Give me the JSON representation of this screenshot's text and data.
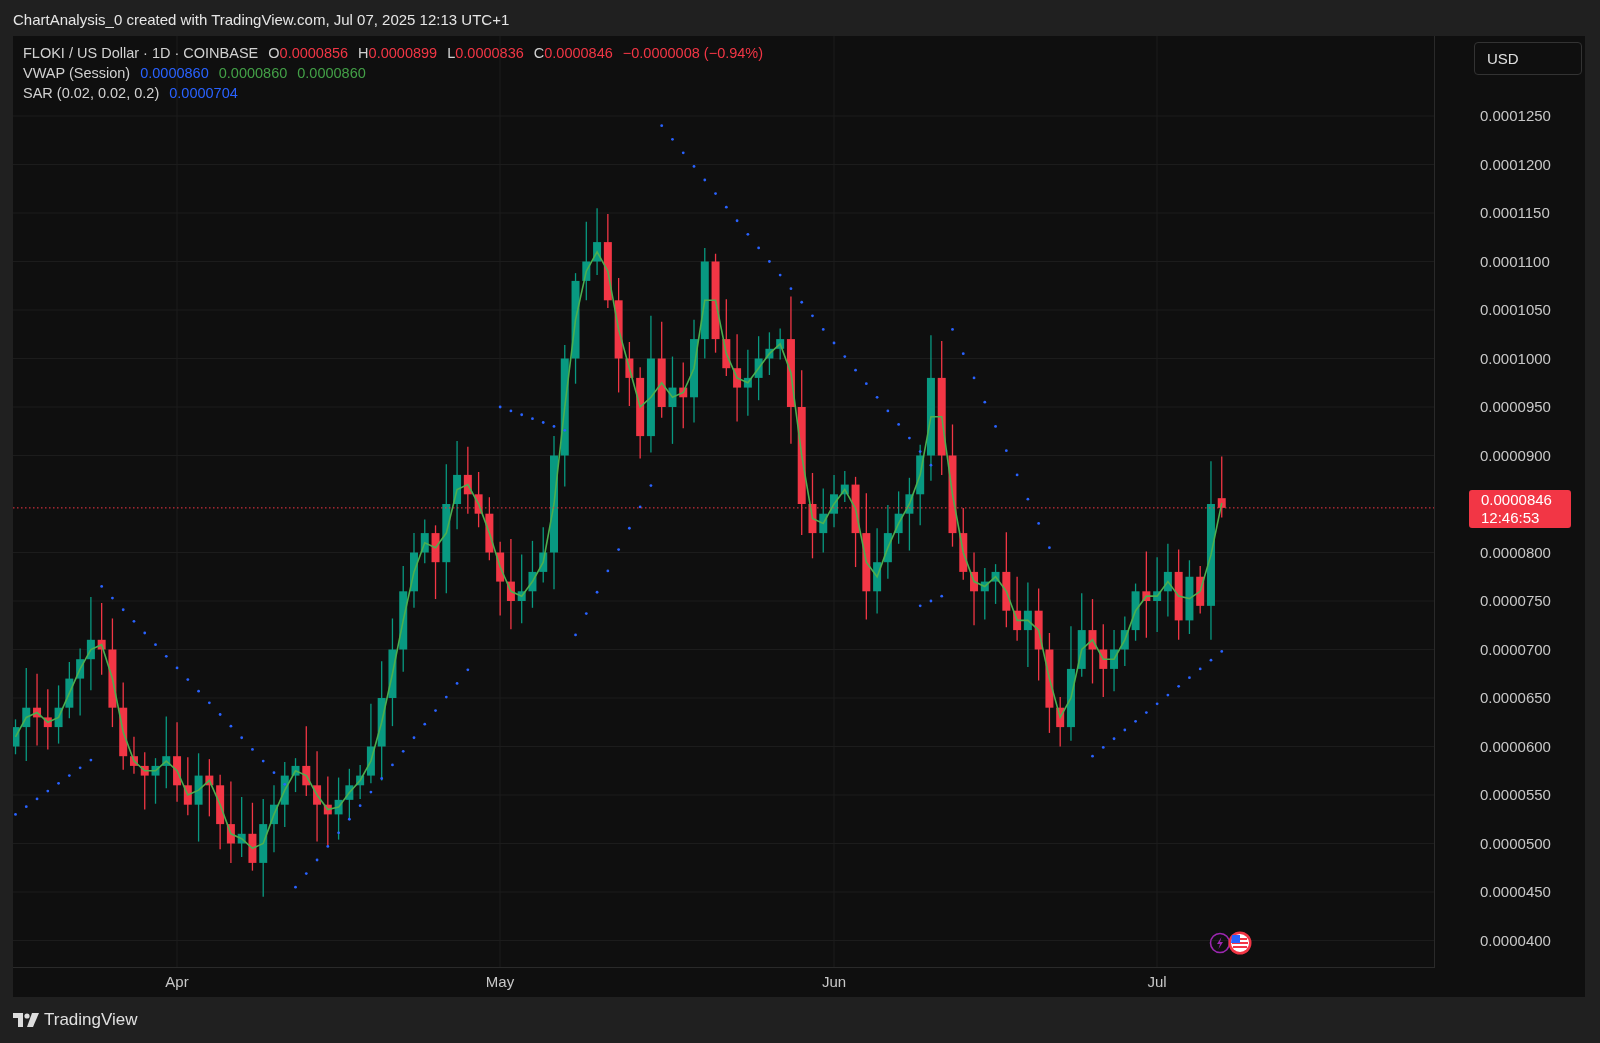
{
  "header": {
    "title": "ChartAnalysis_0 created with TradingView.com, Jul 07, 2025 12:13 UTC+1"
  },
  "legend": {
    "symbol": "FLOKI / US Dollar · 1D · COINBASE",
    "fields": [
      {
        "label": "O",
        "value": "0.0000856"
      },
      {
        "label": "H",
        "value": "0.0000899"
      },
      {
        "label": "L",
        "value": "0.0000836"
      },
      {
        "label": "C",
        "value": "0.0000846"
      }
    ],
    "change": "−0.0000008 (−0.94%)",
    "indicators": [
      {
        "name": "VWAP (Session)",
        "values": [
          {
            "text": "0.0000860",
            "color": "#2962ff"
          },
          {
            "text": "0.0000860",
            "color": "#43a047"
          },
          {
            "text": "0.0000860",
            "color": "#43a047"
          }
        ]
      },
      {
        "name": "SAR (0.02, 0.02, 0.2)",
        "values": [
          {
            "text": "0.0000704",
            "color": "#2962ff"
          }
        ]
      }
    ]
  },
  "currency_button": "USD",
  "price_axis": [
    "0.0001250",
    "0.0001200",
    "0.0001150",
    "0.0001100",
    "0.0001050",
    "0.0001000",
    "0.0000950",
    "0.0000900",
    "0.0000800",
    "0.0000750",
    "0.0000700",
    "0.0000650",
    "0.0000600",
    "0.0000550",
    "0.0000500",
    "0.0000450",
    "0.0000400"
  ],
  "last_price": {
    "value": "0.0000846",
    "countdown": "12:46:53"
  },
  "time_axis": [
    "Apr",
    "May",
    "Jun",
    "Jul"
  ],
  "footer": {
    "logo_text": "TradingView"
  }
}
